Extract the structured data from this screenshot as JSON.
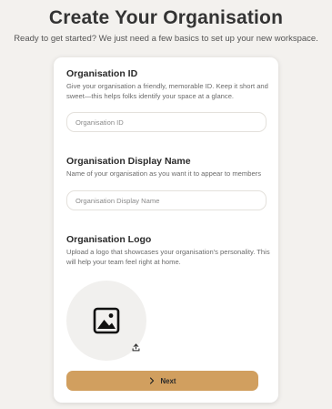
{
  "header": {
    "title": "Create Your Organisation",
    "subtitle": "Ready to get started? We just need a few basics to set up your new workspace."
  },
  "form": {
    "org_id": {
      "label": "Organisation ID",
      "description": "Give your organisation a friendly, memorable ID. Keep it short and sweet—this helps folks identify your space at a glance.",
      "placeholder": "Organisation ID",
      "value": ""
    },
    "display_name": {
      "label": "Organisation Display Name",
      "description": "Name of your organisation as you want it to appear to members",
      "placeholder": "Organisation Display Name",
      "value": ""
    },
    "logo": {
      "label": "Organisation Logo",
      "description": "Upload a logo that showcases your organisation's personality. This will help your team feel right at home.",
      "placeholder_icon": "image-icon",
      "upload_icon": "upload-icon"
    },
    "next_button": {
      "label": "Next",
      "icon": "chevron-right-icon"
    }
  },
  "colors": {
    "background": "#f3f1ee",
    "card": "#ffffff",
    "accent": "#d19f5f"
  }
}
